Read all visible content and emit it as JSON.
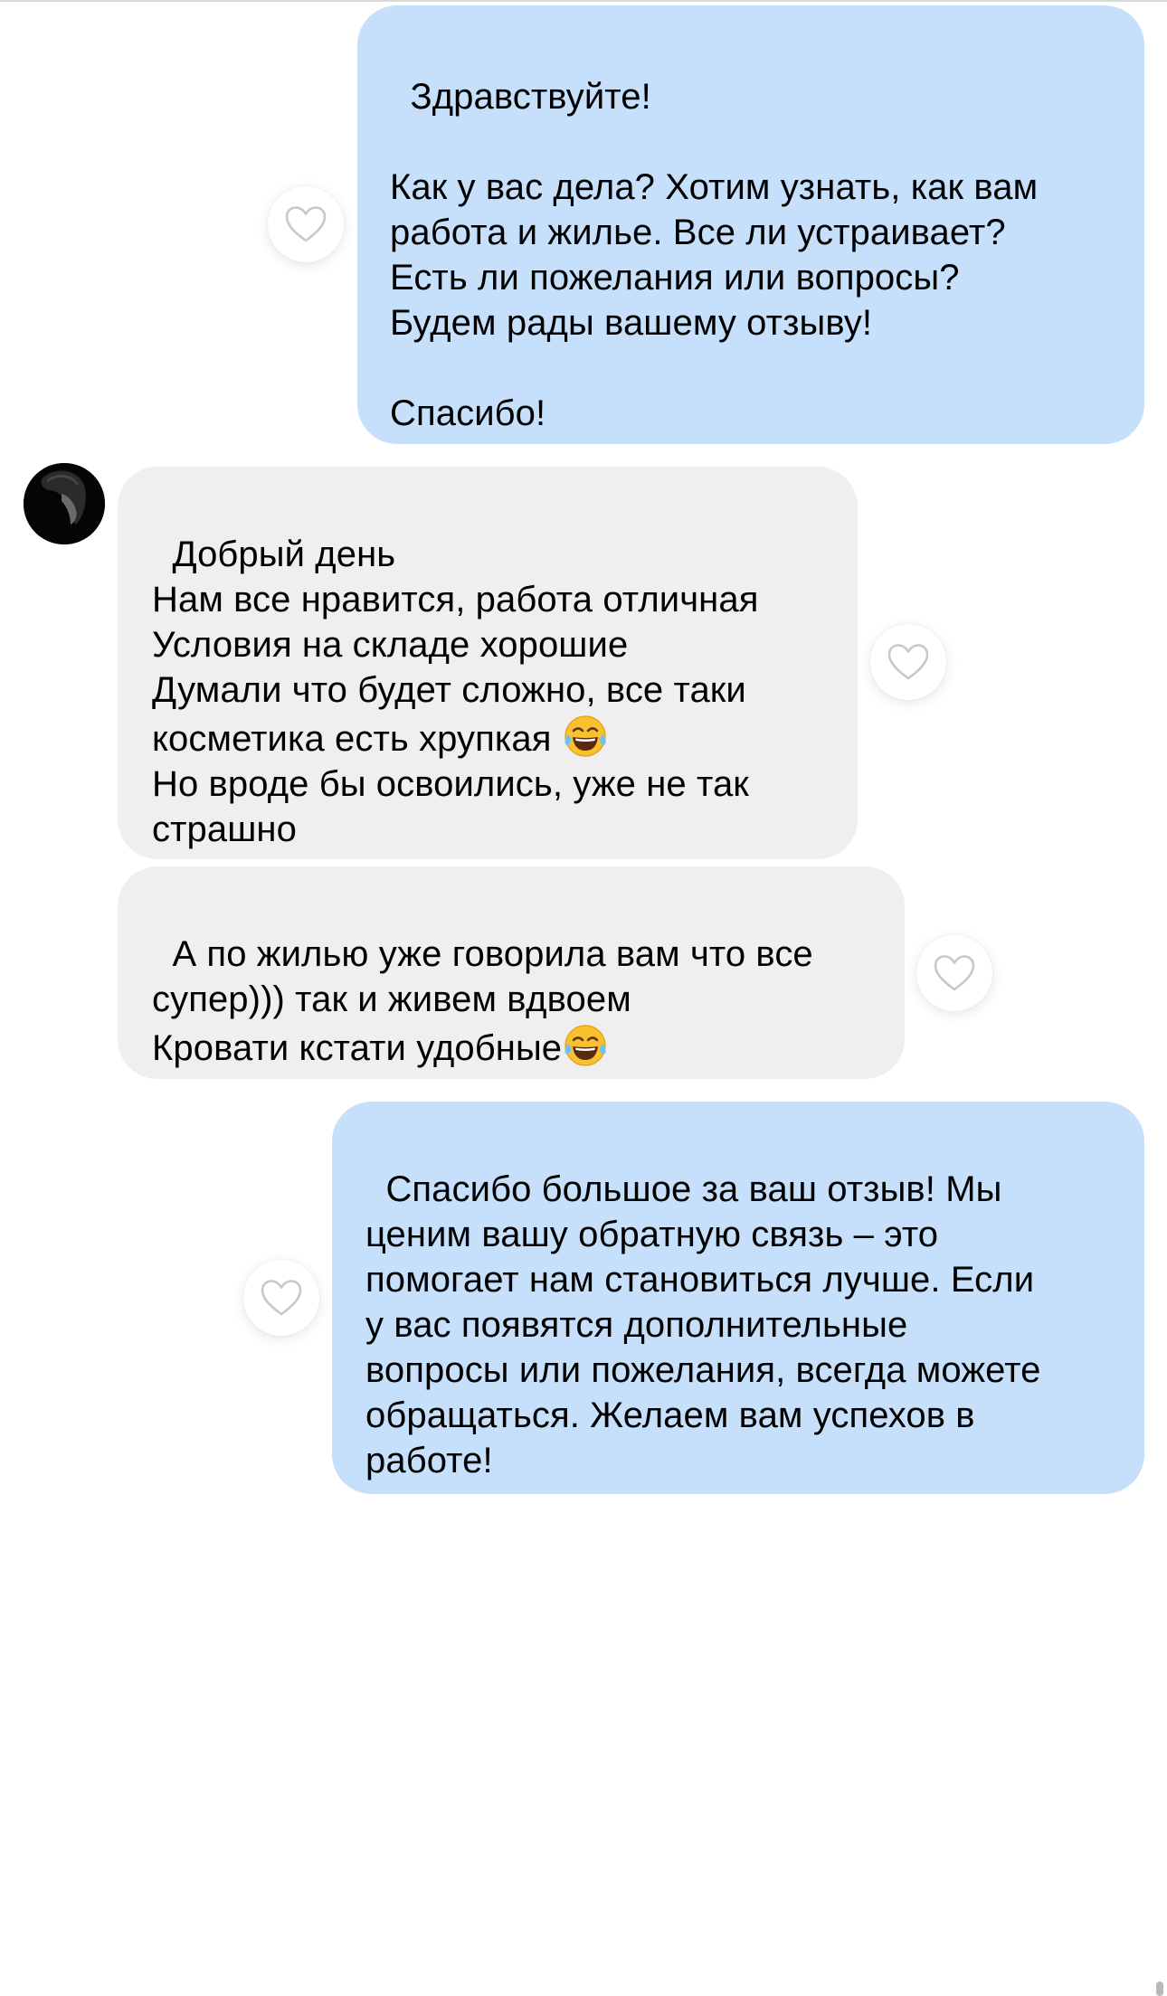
{
  "messages": [
    {
      "direction": "outgoing",
      "text": "Здравствуйте!\n\nКак у вас дела? Хотим узнать, как вам\nработа и жилье. Все ли устраивает?\nЕсть ли пожелания или вопросы?\nБудем рады вашему отзыву!\n\nСпасибо!",
      "reaction_icon": "heart-outline-icon"
    },
    {
      "direction": "incoming",
      "text_before_emoji": "Добрый день\nНам все нравится, работа отличная\nУсловия на складе хорошие\nДумали что будет сложно, все таки\nкосметика есть хрупкая ",
      "emoji": "😂",
      "text_after_emoji": "\nНо вроде бы освоились, уже не так\nстрашно",
      "reaction_icon": "heart-outline-icon"
    },
    {
      "direction": "incoming",
      "text_before_emoji": "А по жилью уже говорила вам что все\nсупер))) так и живем вдвоем\nКровати кстати удобные",
      "emoji": "😂",
      "reaction_icon": "heart-outline-icon"
    },
    {
      "direction": "outgoing",
      "text": "Спасибо большое за ваш отзыв! Мы\nценим вашу обратную связь – это\nпомогает нам становиться лучше. Если\nу вас появятся дополнительные\nвопросы или пожелания, всегда можете\nобращаться. Желаем вам успехов в\nработе!",
      "reaction_icon": "heart-outline-icon"
    }
  ],
  "colors": {
    "outgoing_bubble": "#c6e0fb",
    "incoming_bubble": "#efeff0",
    "heart_stroke": "#c7c7cc"
  }
}
